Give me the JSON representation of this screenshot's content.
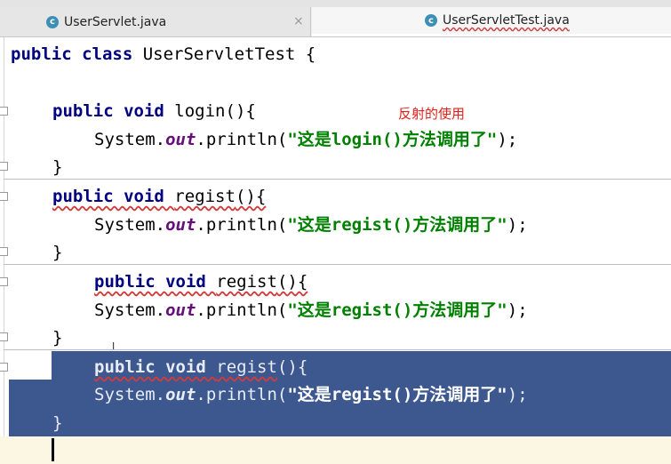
{
  "tabs": [
    {
      "label": "UserServlet.java",
      "icon": "c-class-icon",
      "active": false
    },
    {
      "label": "UserServletTest.java",
      "icon": "c-class-icon",
      "active": true
    }
  ],
  "close_glyph": "×",
  "annotation": "反射的使用",
  "code": {
    "class_line": {
      "kw": "public class",
      "name": "UserServletTest",
      "brace": "{"
    },
    "m1_sig": {
      "kw": "public void",
      "name": "login",
      "rest": "(){"
    },
    "m1_body": {
      "pre": "System.",
      "out": "out",
      "mid": ".println(",
      "str": "\"这是login()方法调用了\"",
      "end": ");"
    },
    "m1_close": "}",
    "m2_sig": {
      "kw": "public void",
      "name": "regist",
      "rest": "(){"
    },
    "m2_body": {
      "pre": "System.",
      "out": "out",
      "mid": ".println(",
      "str": "\"这是regist()方法调用了\"",
      "end": ");"
    },
    "m2_close": "}",
    "m3_sig": {
      "kw": "public void",
      "name": "regist",
      "rest": "(){"
    },
    "m3_body": {
      "pre": "System.",
      "out": "out",
      "mid": ".println(",
      "str": "\"这是regist()方法调用了\"",
      "end": ");"
    },
    "m3_close": "}",
    "m4_sig": {
      "kw": "public void",
      "name": "regist",
      "rest": "(){"
    },
    "m4_body": {
      "pre": "System.",
      "out": "out",
      "mid": ".println(",
      "str": "\"这是regist()方法调用了\"",
      "end": ");"
    },
    "m4_close": "}"
  },
  "cursor_glyph": "I",
  "colors": {
    "keyword": "#000080",
    "string": "#008000",
    "static_field": "#660e7a",
    "selection": "#3d578f",
    "annotation": "#e2211c"
  }
}
